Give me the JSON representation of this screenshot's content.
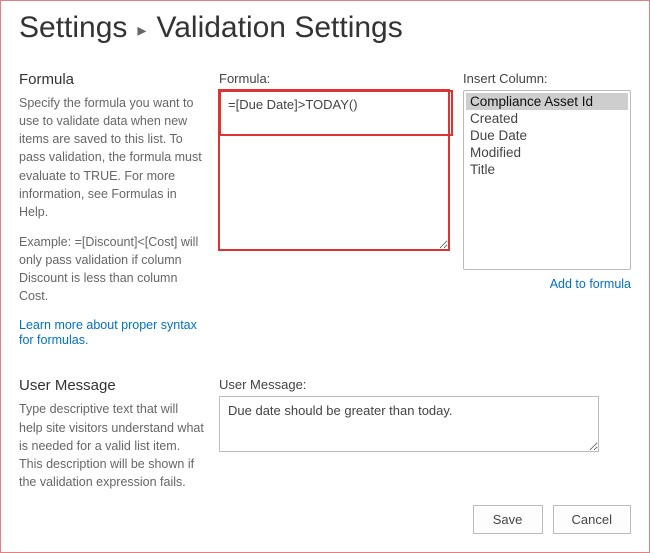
{
  "breadcrumb": {
    "parent": "Settings",
    "current": "Validation Settings"
  },
  "formula_section": {
    "title": "Formula",
    "help": "Specify the formula you want to use to validate data when new items are saved to this list. To pass validation, the formula must evaluate to TRUE. For more information, see Formulas in Help.",
    "example": "Example: =[Discount]<[Cost] will only pass validation if column Discount is less than column Cost.",
    "learn_link": "Learn more about proper syntax for formulas.",
    "field_label": "Formula:",
    "value": "=[Due Date]>TODAY()",
    "insert_label": "Insert Column:",
    "columns": [
      "Compliance Asset Id",
      "Created",
      "Due Date",
      "Modified",
      "Title"
    ],
    "selected_column": "Compliance Asset Id",
    "add_link": "Add to formula"
  },
  "message_section": {
    "title": "User Message",
    "help": "Type descriptive text that will help site visitors understand what is needed for a valid list item. This description will be shown if the validation expression fails.",
    "field_label": "User Message:",
    "value": "Due date should be greater than today."
  },
  "footer": {
    "save": "Save",
    "cancel": "Cancel"
  }
}
